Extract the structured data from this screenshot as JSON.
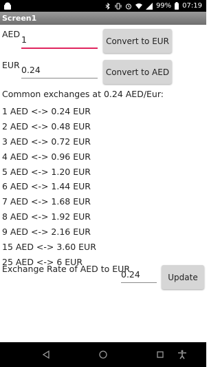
{
  "status_bar": {
    "battery": "99%",
    "time": "07:19",
    "icons": [
      "android-icon",
      "bluetooth-icon",
      "vibrate-icon",
      "alarm-icon",
      "wifi-icon",
      "signal-icon",
      "battery-icon"
    ]
  },
  "title_bar": {
    "title": "Screen1"
  },
  "aed": {
    "label": "AED",
    "value": "1",
    "button": "Convert to EUR"
  },
  "eur": {
    "label": "EUR",
    "value": "0.24",
    "button": "Convert to AED"
  },
  "heading": "Common exchanges at 0.24 AED/Eur:",
  "rates": [
    "1 AED <-> 0.24 EUR",
    "2 AED <-> 0.48 EUR",
    "3 AED <-> 0.72 EUR",
    "4 AED <-> 0.96 EUR",
    "5 AED <-> 1.20 EUR",
    "6 AED <-> 1.44 EUR",
    "7 AED <-> 1.68 EUR",
    "8 AED <-> 1.92 EUR",
    "9 AED <-> 2.16 EUR",
    "15 AED <-> 3.60 EUR",
    "25 AED <-> 6 EUR"
  ],
  "rate_update": {
    "label": "Exchange Rate of AED to EUR",
    "value": "0.24",
    "button": "Update"
  },
  "nav_bar": {
    "icons": [
      "back-icon",
      "home-icon",
      "recents-icon",
      "accessibility-icon"
    ]
  },
  "colors": {
    "accent": "#e0245e",
    "button_bg": "#d6d6d6",
    "title_bar": "#7f7f7f"
  }
}
